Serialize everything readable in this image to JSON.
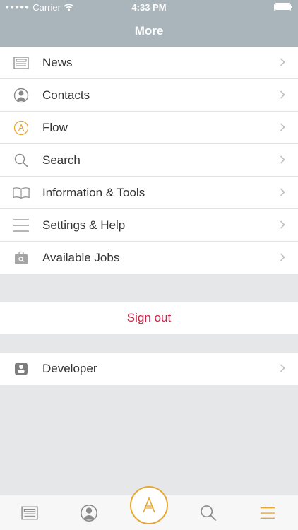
{
  "status_bar": {
    "carrier": "Carrier",
    "time": "4:33 PM"
  },
  "nav": {
    "title": "More"
  },
  "menu": {
    "items": [
      {
        "label": "News",
        "icon": "newspaper-icon"
      },
      {
        "label": "Contacts",
        "icon": "contacts-icon"
      },
      {
        "label": "Flow",
        "icon": "flow-logo-icon"
      },
      {
        "label": "Search",
        "icon": "search-icon"
      },
      {
        "label": "Information & Tools",
        "icon": "book-icon"
      },
      {
        "label": "Settings & Help",
        "icon": "menu-lines-icon"
      },
      {
        "label": "Available Jobs",
        "icon": "jobs-bag-icon"
      }
    ]
  },
  "sign_out": {
    "label": "Sign out"
  },
  "developer": {
    "label": "Developer",
    "icon": "developer-icon"
  },
  "tabbar": {
    "tabs": [
      "newspaper-icon",
      "contacts-icon",
      "flow-logo-icon",
      "search-icon",
      "menu-lines-icon"
    ],
    "active": "menu-lines-icon"
  },
  "colors": {
    "header": "#a9b5bb",
    "accent": "#e8a732",
    "sign_out": "#cc2244",
    "background": "#e6e7e9"
  }
}
